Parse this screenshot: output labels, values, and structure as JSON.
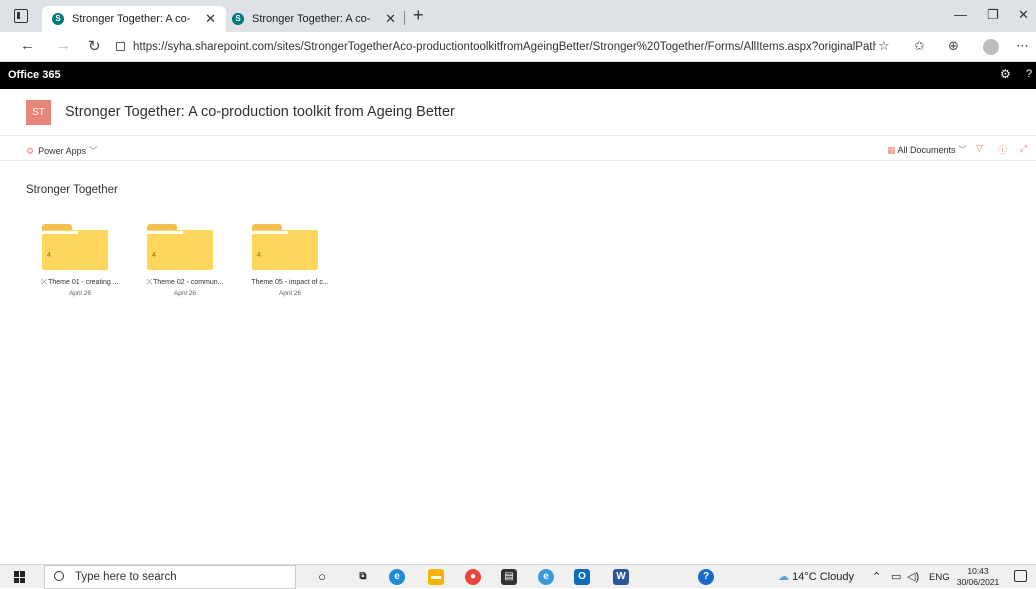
{
  "browser": {
    "tabs": [
      {
        "title": "Stronger Together: A co-producti",
        "active": true
      },
      {
        "title": "Stronger Together: A co-producti",
        "active": false
      }
    ],
    "url": "https://syha.sharepoint.com/sites/StrongerTogetherAco-productiontoolkitfromAgeingBetter/Stronger%20Together/Forms/AllItems.aspx?originalPath=a..."
  },
  "o365": {
    "brand": "Office 365"
  },
  "site": {
    "logo_text": "ST",
    "title": "Stronger Together: A co-production toolkit from Ageing Better"
  },
  "commandbar": {
    "power_apps": "Power Apps",
    "view": "All Documents"
  },
  "library": {
    "title": "Stronger Together",
    "folders": [
      {
        "name": "Theme 01 - creating ...",
        "date": "April 26",
        "count": "4",
        "sync": true
      },
      {
        "name": "Theme 02 - commun...",
        "date": "April 26",
        "count": "4",
        "sync": true
      },
      {
        "name": "Theme 05 - impact of c...",
        "date": "April 26",
        "count": "4",
        "sync": false
      }
    ]
  },
  "taskbar": {
    "search_placeholder": "Type here to search",
    "weather": "14°C  Cloudy",
    "language": "ENG",
    "time": "10:43",
    "date": "30/06/2021"
  },
  "colors": {
    "accent": "#e8857a",
    "folder": "#ffd65c",
    "o365_bar": "#000000"
  }
}
